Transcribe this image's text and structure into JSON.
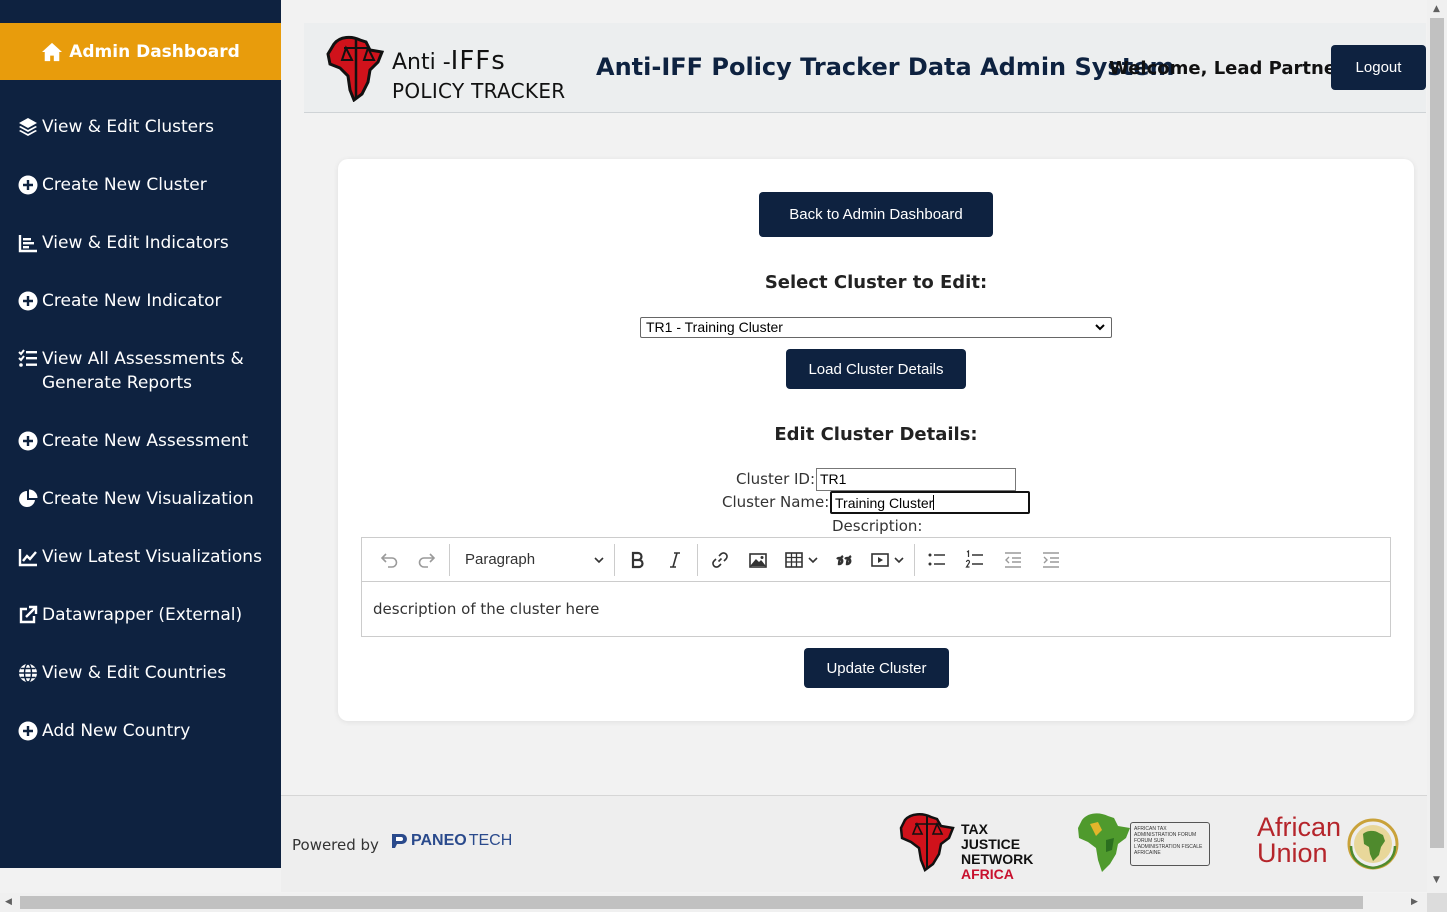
{
  "sidebar": {
    "home_label": "Admin Dashboard",
    "items": [
      {
        "label": "View & Edit Clusters",
        "icon": "layers-icon"
      },
      {
        "label": "Create New Cluster",
        "icon": "plus-circle-icon"
      },
      {
        "label": "View & Edit Indicators",
        "icon": "chart-icon"
      },
      {
        "label": "Create New Indicator",
        "icon": "plus-circle-icon"
      },
      {
        "label": "View All Assessments & Generate Reports",
        "icon": "tasks-icon"
      },
      {
        "label": "Create New Assessment",
        "icon": "plus-circle-icon"
      },
      {
        "label": "Create New Visualization",
        "icon": "pie-icon"
      },
      {
        "label": "View Latest Visualizations",
        "icon": "line-chart-icon"
      },
      {
        "label": "Datawrapper (External)",
        "icon": "external-link-icon"
      },
      {
        "label": "View & Edit Countries",
        "icon": "globe-icon"
      },
      {
        "label": "Add New Country",
        "icon": "plus-circle-icon"
      }
    ],
    "colors": {
      "background": "#0e2240",
      "active": "#e89c0c"
    }
  },
  "header": {
    "logo_line1_a": "Anti -",
    "logo_line1_b": "IFFs",
    "logo_line2": "POLICY TRACKER",
    "title": "Anti-IFF Policy Tracker Data Admin System",
    "welcome": "Welcome, Lead Partner!",
    "logout_label": "Logout"
  },
  "main": {
    "back_button": "Back to Admin Dashboard",
    "select_title": "Select Cluster to Edit:",
    "selected_cluster": "TR1 - Training Cluster",
    "load_button": "Load Cluster Details",
    "edit_title": "Edit Cluster Details:",
    "cluster_id_label": "Cluster ID:",
    "cluster_id_value": "TR1",
    "cluster_name_label": "Cluster Name:",
    "cluster_name_value": "Training Cluster",
    "description_label": "Description:",
    "editor": {
      "paragraph_style": "Paragraph",
      "content": "description of the cluster here"
    },
    "update_button": "Update Cluster"
  },
  "footer": {
    "powered_by": "Powered by",
    "paneo_a": "PANEO",
    "paneo_b": "TECH",
    "tjn_line1": "TAX JUSTICE",
    "tjn_line2": "NETWORK",
    "tjn_line3": "AFRICA",
    "ataf_text": "AFRICAN TAX ADMINISTRATION FORUM FORUM SUR L'ADMINISTRATION FISCALE AFRICAINE",
    "au_line1": "African",
    "au_line2": "Union"
  }
}
